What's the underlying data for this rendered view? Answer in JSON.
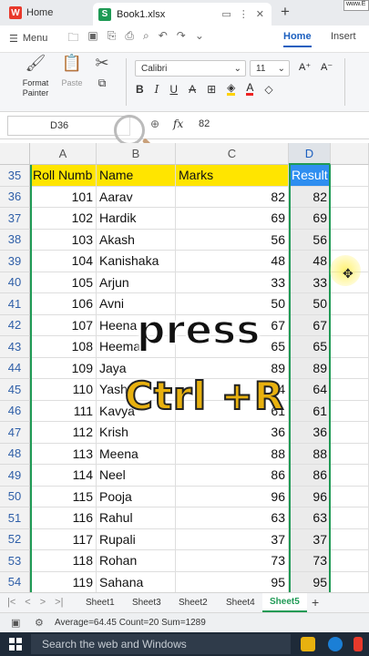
{
  "tabbar": {
    "home_label": "Home",
    "file_tab": "Book1.xlsx",
    "new_tab": "+",
    "corner_text": "www.E"
  },
  "menubar": {
    "menu_label": "Menu",
    "tabs": [
      "Home",
      "Insert"
    ]
  },
  "ribbon": {
    "format_painter": "Format Painter",
    "paste": "Paste",
    "font_name": "Calibri",
    "font_size": "11"
  },
  "formula": {
    "cell_ref": "D36",
    "fx": "fx",
    "value": "82"
  },
  "grid": {
    "columns": [
      "A",
      "B",
      "C",
      "D"
    ],
    "header_row": {
      "row": "35",
      "a": "Roll Numb",
      "b": "Name",
      "c": "Marks",
      "d": "Result"
    },
    "rows": [
      {
        "row": "36",
        "a": "101",
        "b": "Aarav",
        "c": "82",
        "d": "82"
      },
      {
        "row": "37",
        "a": "102",
        "b": "Hardik",
        "c": "69",
        "d": "69"
      },
      {
        "row": "38",
        "a": "103",
        "b": "Akash",
        "c": "56",
        "d": "56"
      },
      {
        "row": "39",
        "a": "104",
        "b": "Kanishaka",
        "c": "48",
        "d": "48"
      },
      {
        "row": "40",
        "a": "105",
        "b": "Arjun",
        "c": "33",
        "d": "33"
      },
      {
        "row": "41",
        "a": "106",
        "b": "Avni",
        "c": "50",
        "d": "50"
      },
      {
        "row": "42",
        "a": "107",
        "b": "Heena",
        "c": "67",
        "d": "67"
      },
      {
        "row": "43",
        "a": "108",
        "b": "Heema",
        "c": "65",
        "d": "65"
      },
      {
        "row": "44",
        "a": "109",
        "b": "Jaya",
        "c": "89",
        "d": "89"
      },
      {
        "row": "45",
        "a": "110",
        "b": "Yash",
        "c": "64",
        "d": "64"
      },
      {
        "row": "46",
        "a": "111",
        "b": "Kavya",
        "c": "61",
        "d": "61"
      },
      {
        "row": "47",
        "a": "112",
        "b": "Krish",
        "c": "36",
        "d": "36"
      },
      {
        "row": "48",
        "a": "113",
        "b": "Meena",
        "c": "88",
        "d": "88"
      },
      {
        "row": "49",
        "a": "114",
        "b": "Neel",
        "c": "86",
        "d": "86"
      },
      {
        "row": "50",
        "a": "115",
        "b": "Pooja",
        "c": "96",
        "d": "96"
      },
      {
        "row": "51",
        "a": "116",
        "b": "Rahul",
        "c": "63",
        "d": "63"
      },
      {
        "row": "52",
        "a": "117",
        "b": "Rupali",
        "c": "37",
        "d": "37"
      },
      {
        "row": "53",
        "a": "118",
        "b": "Rohan",
        "c": "73",
        "d": "73"
      },
      {
        "row": "54",
        "a": "119",
        "b": "Sahana",
        "c": "95",
        "d": "95"
      }
    ]
  },
  "overlay": {
    "line1": "press",
    "line2": "Ctrl +R"
  },
  "sheets": {
    "tabs": [
      "Sheet1",
      "Sheet3",
      "Sheet2",
      "Sheet4",
      "Sheet5"
    ],
    "active": "Sheet5",
    "add": "+"
  },
  "status": {
    "summary": "Average=64.45  Count=20  Sum=1289"
  },
  "taskbar": {
    "search_placeholder": "Search the web and Windows"
  },
  "colors": {
    "header_yellow": "#ffe500",
    "result_blue": "#2e8ef0",
    "selection_green": "#1f9a55",
    "overlay_gold": "#e8b10f"
  }
}
